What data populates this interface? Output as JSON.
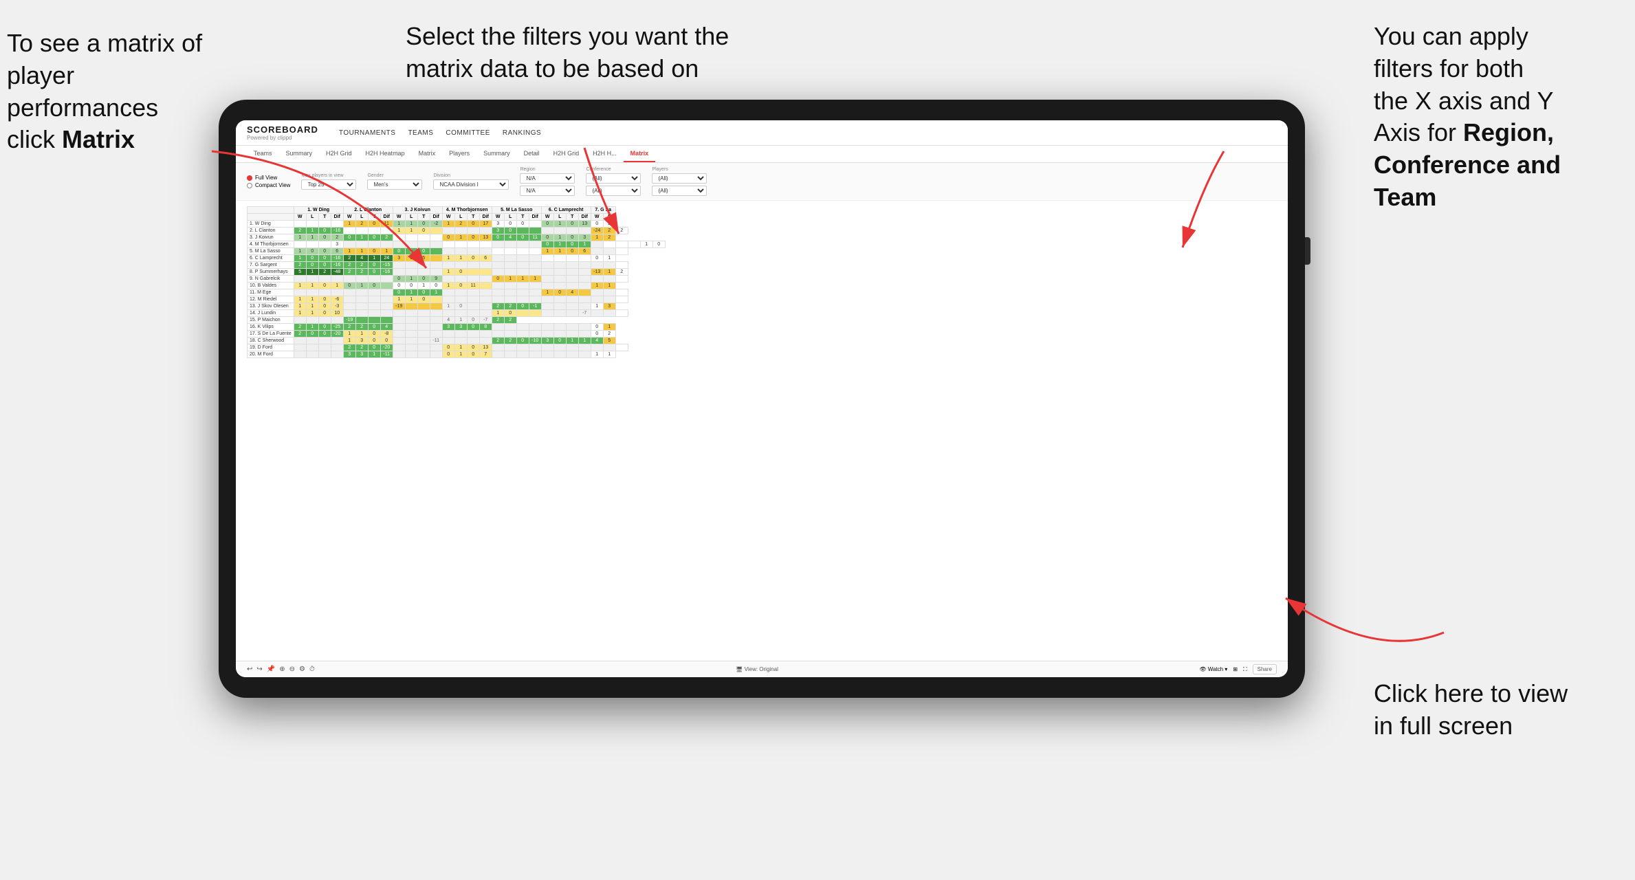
{
  "annotations": {
    "left": {
      "line1": "To see a matrix of",
      "line2": "player performances",
      "line3_normal": "click ",
      "line3_bold": "Matrix"
    },
    "center": {
      "line1": "Select the filters you want the",
      "line2": "matrix data to be based on"
    },
    "right": {
      "line1": "You  can apply",
      "line2": "filters for both",
      "line3": "the X axis and Y",
      "line4_normal": "Axis for ",
      "line4_bold": "Region,",
      "line5_bold": "Conference and",
      "line6_bold": "Team"
    },
    "bottom_right": {
      "line1": "Click here to view",
      "line2": "in full screen"
    }
  },
  "navbar": {
    "brand": "SCOREBOARD",
    "powered_by": "Powered by clippd",
    "links": [
      "TOURNAMENTS",
      "TEAMS",
      "COMMITTEE",
      "RANKINGS"
    ]
  },
  "sub_nav": {
    "tabs": [
      "Teams",
      "Summary",
      "H2H Grid",
      "H2H Heatmap",
      "Matrix",
      "Players",
      "Summary",
      "Detail",
      "H2H Grid",
      "H2H H...",
      "Matrix"
    ],
    "active_index": 10
  },
  "filters": {
    "views": [
      "Full View",
      "Compact View"
    ],
    "active_view": "Full View",
    "max_players_label": "Max players in view",
    "max_players_value": "Top 25",
    "gender_label": "Gender",
    "gender_value": "Men's",
    "division_label": "Division",
    "division_value": "NCAA Division I",
    "region_label": "Region",
    "region_value": "N/A",
    "conference_label": "Conference",
    "conference_value": "(All)",
    "players_label": "Players",
    "players_value": "(All)"
  },
  "matrix": {
    "column_headers": [
      "1. W Ding",
      "2. L Clanton",
      "3. J Koivun",
      "4. M Thorbjornsen",
      "5. M La Sasso",
      "6. C Lamprecht",
      "7. G Sa"
    ],
    "sub_headers": [
      "W",
      "L",
      "T",
      "Dif"
    ],
    "rows": [
      {
        "name": "1. W Ding",
        "cells": [
          "",
          "",
          "",
          "",
          "1",
          "2",
          "0",
          "11",
          "1",
          "1",
          "0",
          "-2",
          "1",
          "2",
          "0",
          "17",
          "3",
          "0",
          "0",
          "",
          "0",
          "1",
          "0",
          "13",
          "0",
          "2"
        ]
      },
      {
        "name": "2. L Clanton",
        "cells": [
          "2",
          "1",
          "0",
          "-16",
          "",
          "",
          "",
          "",
          "1",
          "1",
          "0",
          "",
          "",
          "",
          "",
          "",
          "3",
          "0",
          "",
          "",
          "",
          "",
          "",
          "",
          "-24",
          "2",
          "2"
        ]
      },
      {
        "name": "3. J Koivun",
        "cells": [
          "1",
          "1",
          "0",
          "2",
          "0",
          "1",
          "0",
          "2",
          "",
          "",
          "",
          "",
          "0",
          "1",
          "0",
          "13",
          "0",
          "4",
          "0",
          "11",
          "0",
          "1",
          "0",
          "3",
          "1",
          "2"
        ]
      },
      {
        "name": "4. M Thorbjornsen",
        "cells": [
          "",
          "",
          "",
          "3",
          "",
          "",
          "",
          "",
          "",
          "",
          "",
          "",
          "",
          "",
          "",
          "",
          "",
          "",
          "",
          "",
          "0",
          "1",
          "0",
          "1",
          "",
          "",
          "",
          "",
          "1",
          "0"
        ]
      },
      {
        "name": "5. M La Sasso",
        "cells": [
          "1",
          "0",
          "0",
          "6",
          "1",
          "1",
          "0",
          "1",
          "0",
          "1",
          "0",
          "",
          "",
          "",
          "",
          "",
          "",
          "",
          "",
          "",
          "1",
          "1",
          "0",
          "6",
          "",
          "",
          ""
        ]
      },
      {
        "name": "6. C Lamprecht",
        "cells": [
          "1",
          "0",
          "0",
          "-16",
          "2",
          "4",
          "1",
          "24",
          "3",
          "0",
          "5",
          "",
          "1",
          "1",
          "0",
          "6",
          "",
          "",
          "",
          "",
          "",
          "",
          "",
          "",
          "0",
          "1"
        ]
      },
      {
        "name": "7. G Sargent",
        "cells": [
          "2",
          "0",
          "0",
          "-16",
          "2",
          "2",
          "0",
          "-15",
          "",
          "",
          "",
          "",
          "",
          "",
          "",
          "",
          "",
          "",
          "",
          "",
          "",
          "",
          "",
          "",
          "",
          "",
          ""
        ]
      },
      {
        "name": "8. P Summerhays",
        "cells": [
          "5",
          "1",
          "2",
          "-48",
          "2",
          "2",
          "0",
          "-16",
          "",
          "",
          "",
          "",
          "1",
          "0",
          "",
          "",
          "",
          "",
          "",
          "",
          "",
          "",
          "",
          "",
          "-13",
          "1",
          "2"
        ]
      },
      {
        "name": "9. N Gabrelcik",
        "cells": [
          "",
          "",
          "",
          "",
          "",
          "",
          "",
          "",
          "0",
          "1",
          "0",
          "9",
          "",
          "",
          "",
          "",
          "0",
          "1",
          "1",
          "1",
          "",
          "",
          "",
          "",
          "",
          "",
          ""
        ]
      },
      {
        "name": "10. B Valdes",
        "cells": [
          "1",
          "1",
          "0",
          "1",
          "0",
          "1",
          "0",
          "",
          "0",
          "0",
          "1",
          "0",
          "1",
          "0",
          "11",
          "",
          "",
          "",
          "",
          "",
          "",
          "",
          "",
          "",
          "1",
          "1"
        ]
      },
      {
        "name": "11. M Ege",
        "cells": [
          "",
          "",
          "",
          "",
          "",
          "",
          "",
          "",
          "0",
          "1",
          "0",
          "1",
          "",
          "",
          "",
          "",
          "",
          "",
          "",
          "",
          "1",
          "0",
          "4",
          "",
          "",
          "",
          ""
        ]
      },
      {
        "name": "12. M Riedel",
        "cells": [
          "1",
          "1",
          "0",
          "-6",
          "",
          "",
          "",
          "",
          "1",
          "1",
          "0",
          "",
          "",
          "",
          "",
          "",
          "",
          "",
          "",
          "",
          "",
          "",
          "",
          "",
          "",
          "",
          ""
        ]
      },
      {
        "name": "13. J Skov Olesen",
        "cells": [
          "1",
          "1",
          "0",
          "-3",
          "",
          "",
          "",
          "",
          "-19",
          "",
          "",
          "",
          "1",
          "0",
          "",
          "",
          "2",
          "2",
          "0",
          "-1",
          "",
          "",
          "",
          "",
          "1",
          "3"
        ]
      },
      {
        "name": "14. J Lundin",
        "cells": [
          "1",
          "1",
          "0",
          "10",
          "",
          "",
          "",
          "",
          "",
          "",
          "",
          "",
          "",
          "",
          "",
          "",
          "1",
          "0",
          "",
          "",
          "",
          "",
          "",
          "-7",
          "",
          "",
          ""
        ]
      },
      {
        "name": "15. P Maichon",
        "cells": [
          "",
          "",
          "",
          "",
          "-19",
          "",
          "",
          "",
          "",
          "",
          "",
          "",
          "4",
          "1",
          "0",
          "-7",
          "2",
          "2"
        ]
      },
      {
        "name": "16. K Vilips",
        "cells": [
          "2",
          "1",
          "0",
          "-25",
          "2",
          "2",
          "0",
          "4",
          "",
          "",
          "",
          "",
          "3",
          "3",
          "0",
          "8",
          "",
          "",
          "",
          "",
          "",
          "",
          "",
          "",
          "0",
          "1"
        ]
      },
      {
        "name": "17. S De La Fuente",
        "cells": [
          "2",
          "0",
          "0",
          "-20",
          "1",
          "1",
          "0",
          "-8",
          "",
          "",
          "",
          "",
          "",
          "",
          "",
          "",
          "",
          "",
          "",
          "",
          "",
          "",
          "",
          "",
          "0",
          "2"
        ]
      },
      {
        "name": "18. C Sherwood",
        "cells": [
          "",
          "",
          "",
          "",
          "1",
          "3",
          "0",
          "0",
          "",
          "",
          "",
          "-11",
          "",
          "",
          "",
          "",
          "2",
          "2",
          "0",
          "-10",
          "3",
          "0",
          "1",
          "1",
          "4",
          "5"
        ]
      },
      {
        "name": "19. D Ford",
        "cells": [
          "",
          "",
          "",
          "",
          "2",
          "2",
          "0",
          "-20",
          "",
          "",
          "",
          "",
          "0",
          "1",
          "0",
          "13",
          "",
          "",
          "",
          "",
          "",
          "",
          "",
          "",
          "",
          "",
          ""
        ]
      },
      {
        "name": "20. M Ford",
        "cells": [
          "",
          "",
          "",
          "",
          "3",
          "3",
          "1",
          "-11",
          "",
          "",
          "",
          "",
          "0",
          "1",
          "0",
          "7",
          "",
          "",
          "",
          "",
          "",
          "",
          "",
          "",
          "1",
          "1"
        ]
      }
    ]
  },
  "bottom_toolbar": {
    "view_label": "View: Original",
    "watch_label": "Watch",
    "share_label": "Share",
    "icons": [
      "undo",
      "redo",
      "pin",
      "zoom-in",
      "zoom-out",
      "settings",
      "timer"
    ]
  }
}
